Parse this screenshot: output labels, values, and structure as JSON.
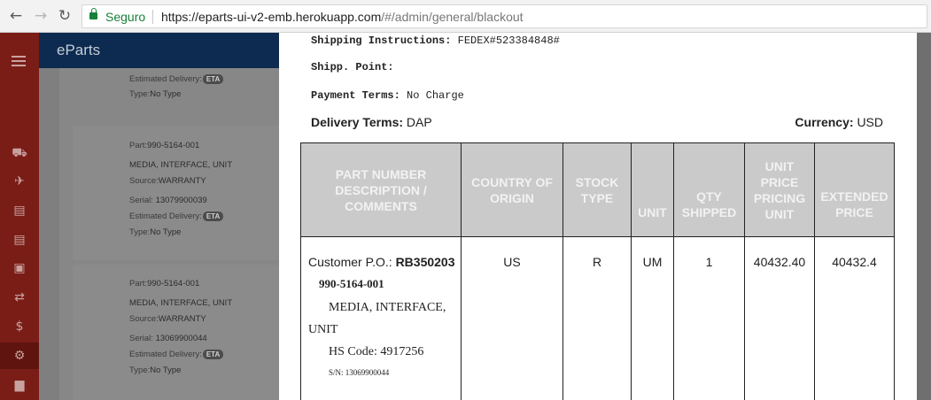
{
  "browser": {
    "secure_label": "Seguro",
    "url_host": "https://eparts-ui-v2-emb.herokuapp.com",
    "url_path": "/#/admin/general/blackout"
  },
  "app": {
    "brand": "eParts",
    "colors": {
      "rail": "#7b1d17",
      "topbar": "#0d2b50"
    }
  },
  "rail_icons": [
    "menu-icon",
    "truck-icon",
    "plane-icon",
    "cart-icon",
    "document-icon",
    "package-icon",
    "exchange-icon",
    "dollar-icon",
    "cogs-icon",
    "chart-icon"
  ],
  "list": {
    "top_partial": {
      "est_label": "Estimated Delivery:",
      "eta": "ETA",
      "type_label": "Type:",
      "type_value": "No Type"
    },
    "items": [
      {
        "part_label": "Part:",
        "part": "990-5164-001",
        "description": "MEDIA, INTERFACE, UNIT",
        "source_label": "Source:",
        "source": "WARRANTY",
        "serial_label": "Serial:",
        "serial": "13079900039",
        "est_label": "Estimated Delivery:",
        "eta": "ETA",
        "type_label": "Type:",
        "type_value": "No Type"
      },
      {
        "part_label": "Part:",
        "part": "990-5164-001",
        "description": "MEDIA, INTERFACE, UNIT",
        "source_label": "Source:",
        "source": "WARRANTY",
        "serial_label": "Serial:",
        "serial": "13069900044",
        "est_label": "Estimated Delivery:",
        "eta": "ETA",
        "type_label": "Type:",
        "type_value": "No Type"
      }
    ]
  },
  "modal": {
    "shipping_label": "Shipping Instructions:",
    "shipping_value": "FEDEX#523384848#",
    "shipp_point_label": "Shipp. Point:",
    "shipp_point_value": "",
    "payment_label": "Payment Terms:",
    "payment_value": "No Charge",
    "delivery_label": "Delivery Terms:",
    "delivery_value": "DAP",
    "currency_label": "Currency:",
    "currency_value": "USD",
    "table": {
      "headers": {
        "part": [
          "PART NUMBER",
          "DESCRIPTION /",
          "COMMENTS"
        ],
        "country": [
          "COUNTRY OF",
          "ORIGIN"
        ],
        "stock": [
          "STOCK",
          "TYPE"
        ],
        "unit": [
          "UNIT"
        ],
        "qty": [
          "QTY",
          "SHIPPED"
        ],
        "unit_price": [
          "UNIT",
          "PRICE",
          "PRICING",
          "UNIT"
        ],
        "extended": [
          "EXTENDED",
          "PRICE"
        ]
      },
      "row": {
        "po_label": "Customer P.O.:",
        "po_value": "RB350203",
        "part_number": "990-5164-001",
        "desc_line1": "MEDIA, INTERFACE,",
        "desc_line2": "UNIT",
        "hs_code": "HS Code: 4917256",
        "serial": "S/N: 13069900044",
        "country": "US",
        "stock_type": "R",
        "unit": "UM",
        "qty": "1",
        "unit_price": "40432.40",
        "extended": "40432.4"
      }
    }
  }
}
